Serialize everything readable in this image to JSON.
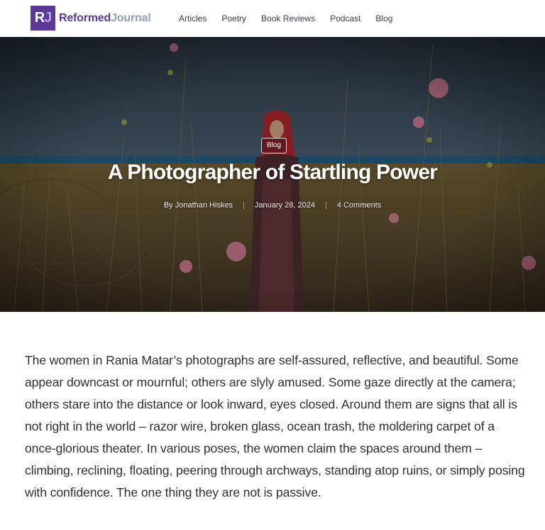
{
  "header": {
    "logo_mark": "R",
    "logo_mark_accent": "J",
    "logo_word_1": "Reformed",
    "logo_word_2": "Journal",
    "nav": [
      {
        "label": "Articles"
      },
      {
        "label": "Poetry"
      },
      {
        "label": "Book Reviews"
      },
      {
        "label": "Podcast"
      },
      {
        "label": "Blog"
      }
    ]
  },
  "hero": {
    "category": "Blog",
    "title": "A Photographer of Startling Power",
    "author": "By Jonathan Hiskes",
    "date": "January 28, 2024",
    "comments": "4 Comments",
    "separator": "|"
  },
  "article": {
    "paragraph": "The women in Rania Matar’s photographs are self-assured, reflective, and beautiful. Some appear downcast or mournful; others are slyly amused. Some gaze directly at the camera; others stare into the distance or look inward, eyes closed. Around them are signs that all is not right in the world – razor wire, broken glass, ocean trash, the moldering carpet of a once-glorious theater. In various poses, the women claim the spaces around them – climbing, reclining, floating, peering through archways, standing atop ruins, or simply posing with confidence. The one thing they are not is passive."
  },
  "colors": {
    "brand": "#5b3a97",
    "brand_secondary": "#8ca1bf"
  }
}
